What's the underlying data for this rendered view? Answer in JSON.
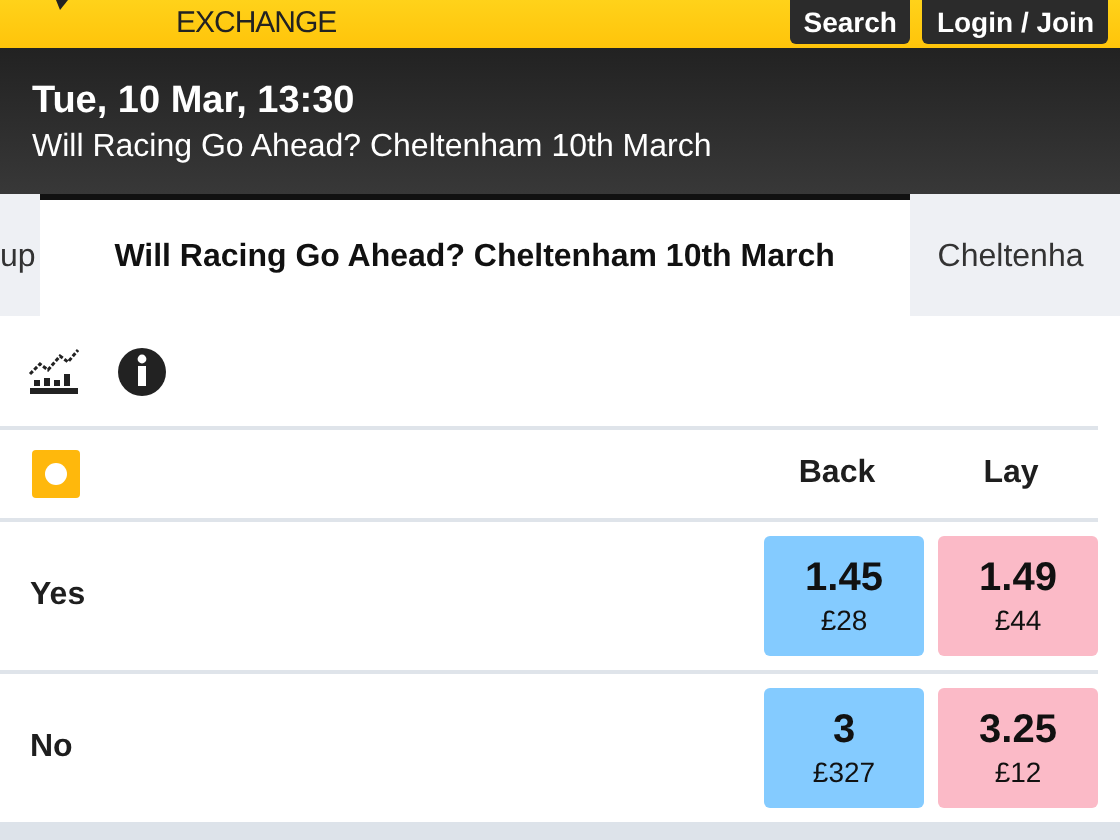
{
  "header": {
    "logo_text": "EXCHANGE",
    "buttons": [
      "Search",
      "Login / Join"
    ]
  },
  "event": {
    "datetime": "Tue, 10 Mar, 13:30",
    "title": "Will Racing Go Ahead? Cheltenham 10th March"
  },
  "tabs": [
    {
      "label": "up",
      "selected": false
    },
    {
      "label": "Will Racing Go Ahead? Cheltenham 10th March",
      "selected": true
    },
    {
      "label": "Cheltenha",
      "selected": false
    }
  ],
  "market": {
    "columns": [
      "Back",
      "Lay"
    ],
    "runners": [
      {
        "name": "Yes",
        "back": {
          "odds": "1.45",
          "amount": "£28"
        },
        "lay": {
          "odds": "1.49",
          "amount": "£44"
        }
      },
      {
        "name": "No",
        "back": {
          "odds": "3",
          "amount": "£327"
        },
        "lay": {
          "odds": "3.25",
          "amount": "£12"
        }
      }
    ]
  }
}
